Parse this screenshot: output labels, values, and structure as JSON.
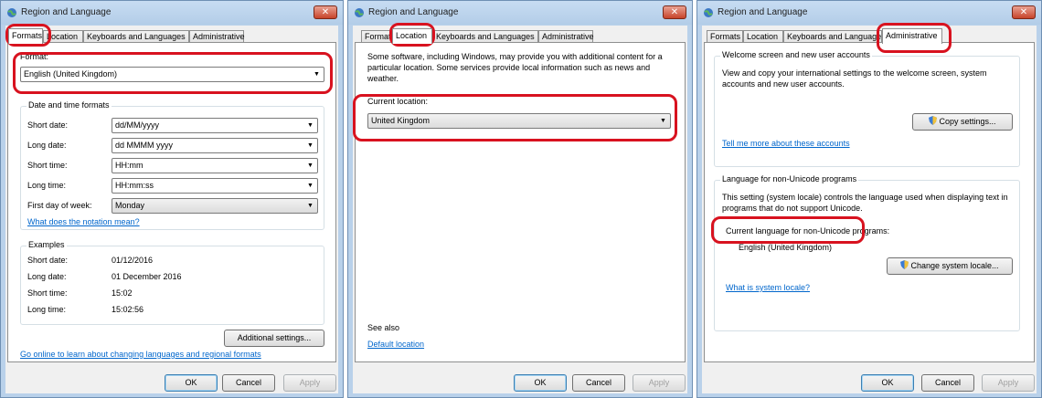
{
  "windows": [
    {
      "title": "Region and Language",
      "close_glyph": "✕",
      "tabs": [
        "Formats",
        "Location",
        "Keyboards and Languages",
        "Administrative"
      ],
      "active_tab": "Formats",
      "formats": {
        "format_label": "Format:",
        "format_value": "English (United Kingdom)",
        "datetime_group_title": "Date and time formats",
        "rows": [
          {
            "label": "Short date:",
            "value": "dd/MM/yyyy"
          },
          {
            "label": "Long date:",
            "value": "dd MMMM yyyy"
          },
          {
            "label": "Short time:",
            "value": "HH:mm"
          },
          {
            "label": "Long time:",
            "value": "HH:mm:ss"
          },
          {
            "label": "First day of week:",
            "value": "Monday"
          }
        ],
        "notation_link": "What does the notation mean?",
        "examples_group_title": "Examples",
        "examples": [
          {
            "label": "Short date:",
            "value": "01/12/2016"
          },
          {
            "label": "Long date:",
            "value": "01 December 2016"
          },
          {
            "label": "Short time:",
            "value": "15:02"
          },
          {
            "label": "Long time:",
            "value": "15:02:56"
          }
        ],
        "additional_settings_button": "Additional settings...",
        "online_link": "Go online to learn about changing languages and regional formats"
      },
      "buttons": {
        "ok": "OK",
        "cancel": "Cancel",
        "apply": "Apply"
      }
    },
    {
      "title": "Region and Language",
      "close_glyph": "✕",
      "tabs": [
        "Formats",
        "Location",
        "Keyboards and Languages",
        "Administrative"
      ],
      "active_tab": "Location",
      "location": {
        "description": "Some software, including Windows, may provide you with additional content for a particular location. Some services provide local information such as news and weather.",
        "current_location_label": "Current location:",
        "current_location_value": "United Kingdom",
        "see_also": "See also",
        "default_location_link": "Default location"
      },
      "buttons": {
        "ok": "OK",
        "cancel": "Cancel",
        "apply": "Apply"
      }
    },
    {
      "title": "Region and Language",
      "close_glyph": "✕",
      "tabs": [
        "Formats",
        "Location",
        "Keyboards and Languages",
        "Administrative"
      ],
      "active_tab": "Administrative",
      "administrative": {
        "welcome_group_title": "Welcome screen and new user accounts",
        "welcome_description": "View and copy your international settings to the welcome screen, system accounts and new user accounts.",
        "copy_settings_button": "Copy settings...",
        "tell_me_link": "Tell me more about these accounts",
        "nonunicode_group_title": "Language for non-Unicode programs",
        "nonunicode_description": "This setting (system locale) controls the language used when displaying text in programs that do not support Unicode.",
        "current_language_label": "Current language for non-Unicode programs:",
        "current_language_value": "English (United Kingdom)",
        "change_locale_button": "Change system locale...",
        "system_locale_link": "What is system locale?"
      },
      "buttons": {
        "ok": "OK",
        "cancel": "Cancel",
        "apply": "Apply"
      }
    }
  ],
  "colors": {
    "frame": "#b9d1ea",
    "highlight": "#d8121f",
    "link": "#0066cc"
  },
  "icons": {
    "title": "globe-icon",
    "close": "close-icon",
    "combo_arrow": "chevron-down-icon",
    "button_shield": "uac-shield-icon"
  }
}
